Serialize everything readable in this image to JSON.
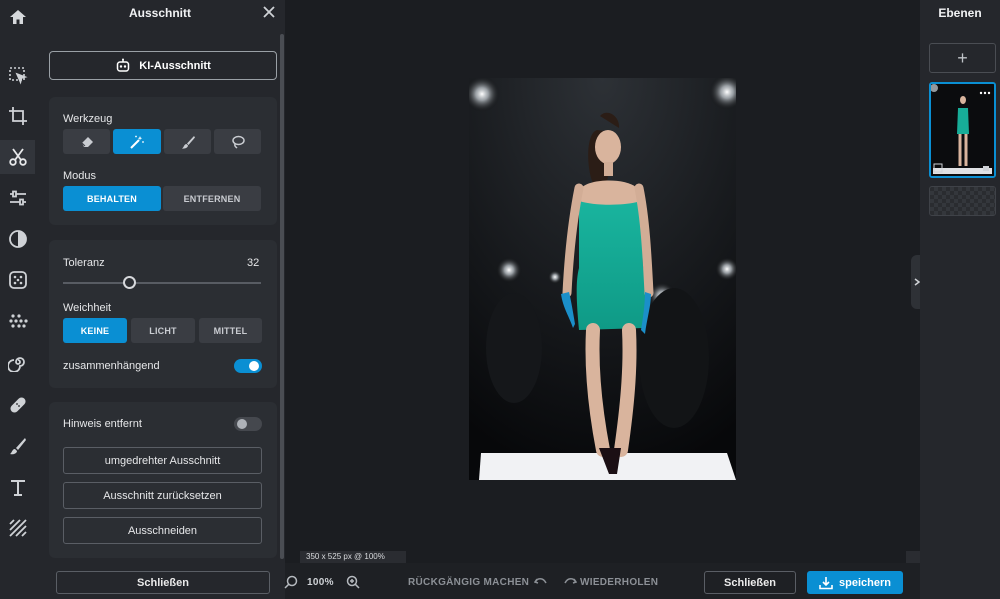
{
  "left_toolbar": {
    "icons": [
      "home-icon",
      "select-icon",
      "crop-icon",
      "cutout-icon",
      "adjust-icon",
      "filter-icon",
      "effects-icon",
      "liquify-icon",
      "swirl-icon",
      "retouch-icon",
      "brush-icon",
      "text-icon",
      "pattern-icon"
    ]
  },
  "panel": {
    "title": "Ausschnitt",
    "ki_button": "KI-Ausschnitt",
    "tool_label": "Werkzeug",
    "mode_label": "Modus",
    "mode_options": [
      "BEHALTEN",
      "ENTFERNEN"
    ],
    "mode_selected": "BEHALTEN",
    "tolerance_label": "Toleranz",
    "tolerance_value": "32",
    "tolerance_fraction": 0.32,
    "softness_label": "Weichheit",
    "softness_options": [
      "KEINE",
      "LICHT",
      "MITTEL"
    ],
    "softness_selected": "KEINE",
    "contiguous_label": "zusammenhängend",
    "contiguous_on": true,
    "hint_label": "Hinweis entfernt",
    "hint_on": false,
    "invert_button": "umgedrehter Ausschnitt",
    "reset_button": "Ausschnitt zurücksetzen",
    "cut_button": "Ausschneiden",
    "close_button": "Schließen"
  },
  "canvas": {
    "dimensions_label": "350 x 525 px @ 100%"
  },
  "bottom_bar": {
    "zoom": "100%",
    "undo": "RÜCKGÄNGIG MACHEN",
    "redo": "WIEDERHOLEN",
    "close": "Schließen",
    "save": "speichern"
  },
  "layers": {
    "title": "Ebenen",
    "add": "+"
  },
  "colors": {
    "accent": "#0a8fd3",
    "panel": "#25272c",
    "card": "#2b2e33",
    "background": "#1b1d21"
  }
}
